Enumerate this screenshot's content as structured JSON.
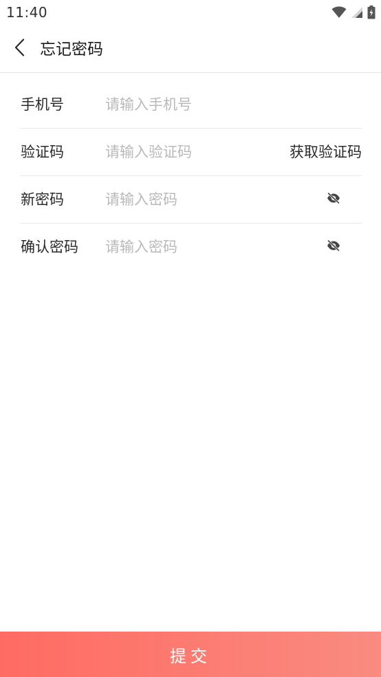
{
  "status_bar": {
    "time": "11:40",
    "icons": [
      "wifi-icon",
      "cellular-signal-icon",
      "battery-charging-icon"
    ]
  },
  "header": {
    "back_icon": "chevron-left-icon",
    "title": "忘记密码"
  },
  "form": {
    "phone": {
      "label": "手机号",
      "value": "",
      "placeholder": "请输入手机号"
    },
    "code": {
      "label": "验证码",
      "value": "",
      "placeholder": "请输入验证码",
      "get_code_label": "获取验证码"
    },
    "new_password": {
      "label": "新密码",
      "value": "",
      "placeholder": "请输入密码",
      "toggle_icon": "eye-off-icon"
    },
    "confirm_password": {
      "label": "确认密码",
      "value": "",
      "placeholder": "请输入密码",
      "toggle_icon": "eye-off-icon"
    }
  },
  "submit": {
    "label": "提交"
  },
  "colors": {
    "accent_start": "#ff6b62",
    "accent_end": "#f98b80",
    "placeholder": "#b9b9b9",
    "divider": "#e8e8e8"
  }
}
